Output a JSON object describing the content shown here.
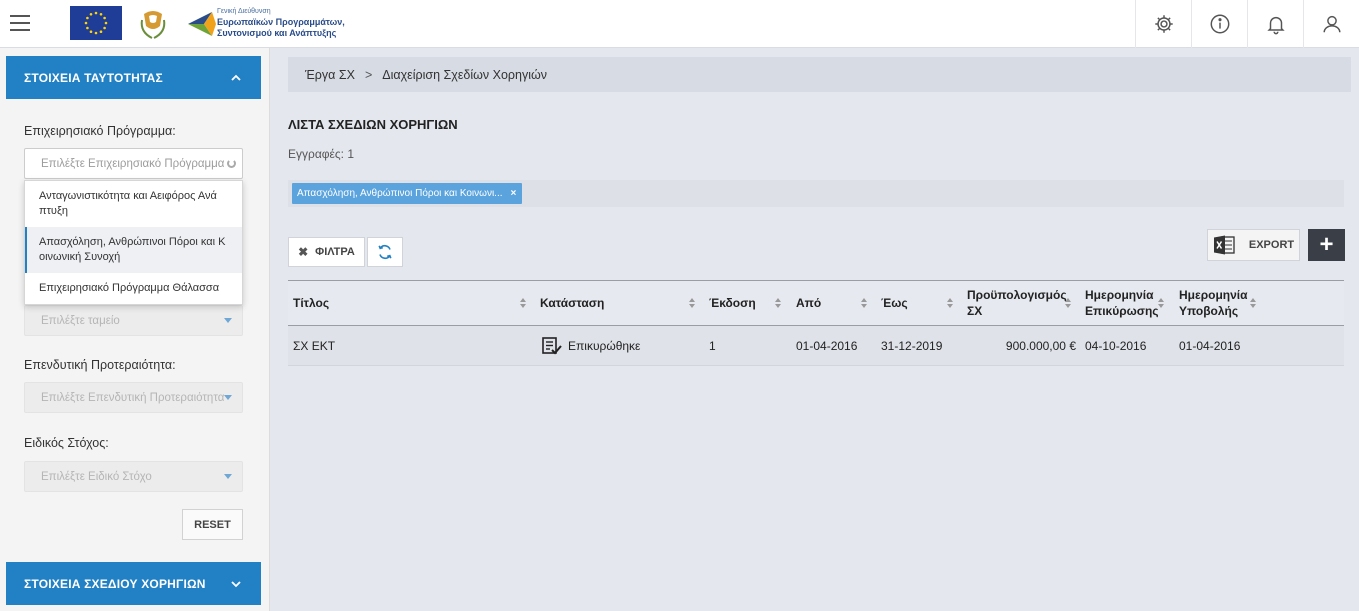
{
  "header": {
    "logo_line1": "Γενική Διεύθυνση",
    "logo_line2": "Ευρωπαϊκών Προγραμμάτων,",
    "logo_line3": "Συντονισμού και Ανάπτυξης",
    "icons": [
      "menu-icon",
      "gear-icon",
      "info-icon",
      "bell-icon",
      "user-icon"
    ]
  },
  "sidebar": {
    "panel1_title": "ΣΤΟΙΧΕΙΑ ΤΑΥΤΟΤΗΤΑΣ",
    "operational_program_label": "Επιχειρησιακό Πρόγραμμα:",
    "operational_program_placeholder": "Επιλέξτε Επιχειρησιακό Πρόγραμμα",
    "dropdown_options": [
      "Ανταγωνιστικότητα και Αειφόρος Ανά πτυξη",
      "Απασχόληση, Ανθρώπινοι Πόροι και Κ οινωνική Συνοχή",
      "Επιχειρησιακό Πρόγραμμα Θάλασσα"
    ],
    "fund_placeholder": "Επιλέξτε ταμείο",
    "investment_priority_label": "Επενδυτική Προτεραιότητα:",
    "investment_priority_placeholder": "Επιλέξτε Επενδυτική Προτεραιότητα",
    "specific_objective_label": "Ειδικός Στόχος:",
    "specific_objective_placeholder": "Επιλέξτε Ειδικό Στόχο",
    "reset_label": "RESET",
    "panel2_title": "ΣΤΟΙΧΕΙΑ ΣΧΕΔΙΟΥ ΧΟΡΗΓΙΩΝ"
  },
  "breadcrumb": {
    "item1": "Έργα ΣΧ",
    "separator": ">",
    "item2": "Διαχείριση Σχεδίων Χορηγιών"
  },
  "main": {
    "list_title": "ΛΙΣΤΑ ΣΧΕΔΙΩΝ ΧΟΡΗΓΙΩΝ",
    "records": "Εγγραφές: 1",
    "chip_label": "Απασχόληση, Ανθρώπινοι Πόροι και Κοινωνι...",
    "chip_close": "×",
    "filters_label": "ΦΙΛΤΡΑ",
    "export_label": "EXPORT",
    "add_label": "+"
  },
  "table": {
    "headers": {
      "title": "Τίτλος",
      "status": "Κατάσταση",
      "version": "Έκδοση",
      "from": "Από",
      "to": "Έως",
      "budget_line1": "Προϋπολογισμός",
      "budget_line2": "ΣΧ",
      "ratification_line1": "Ημερομηνία",
      "ratification_line2": "Επικύρωσης",
      "submission_line1": "Ημερομηνία",
      "submission_line2": "Υποβολής"
    },
    "rows": [
      {
        "title": "ΣΧ ΕΚΤ",
        "status": "Επικυρώθηκε",
        "version": "1",
        "from": "01-04-2016",
        "to": "31-12-2019",
        "budget": "900.000,00 €",
        "ratification_date": "04-10-2016",
        "submission_date": "01-04-2016"
      }
    ]
  },
  "colors": {
    "primary": "#2281c4",
    "chip": "#5ba3dd",
    "dark_button": "#3a3f47",
    "background": "#e4e7ee"
  }
}
